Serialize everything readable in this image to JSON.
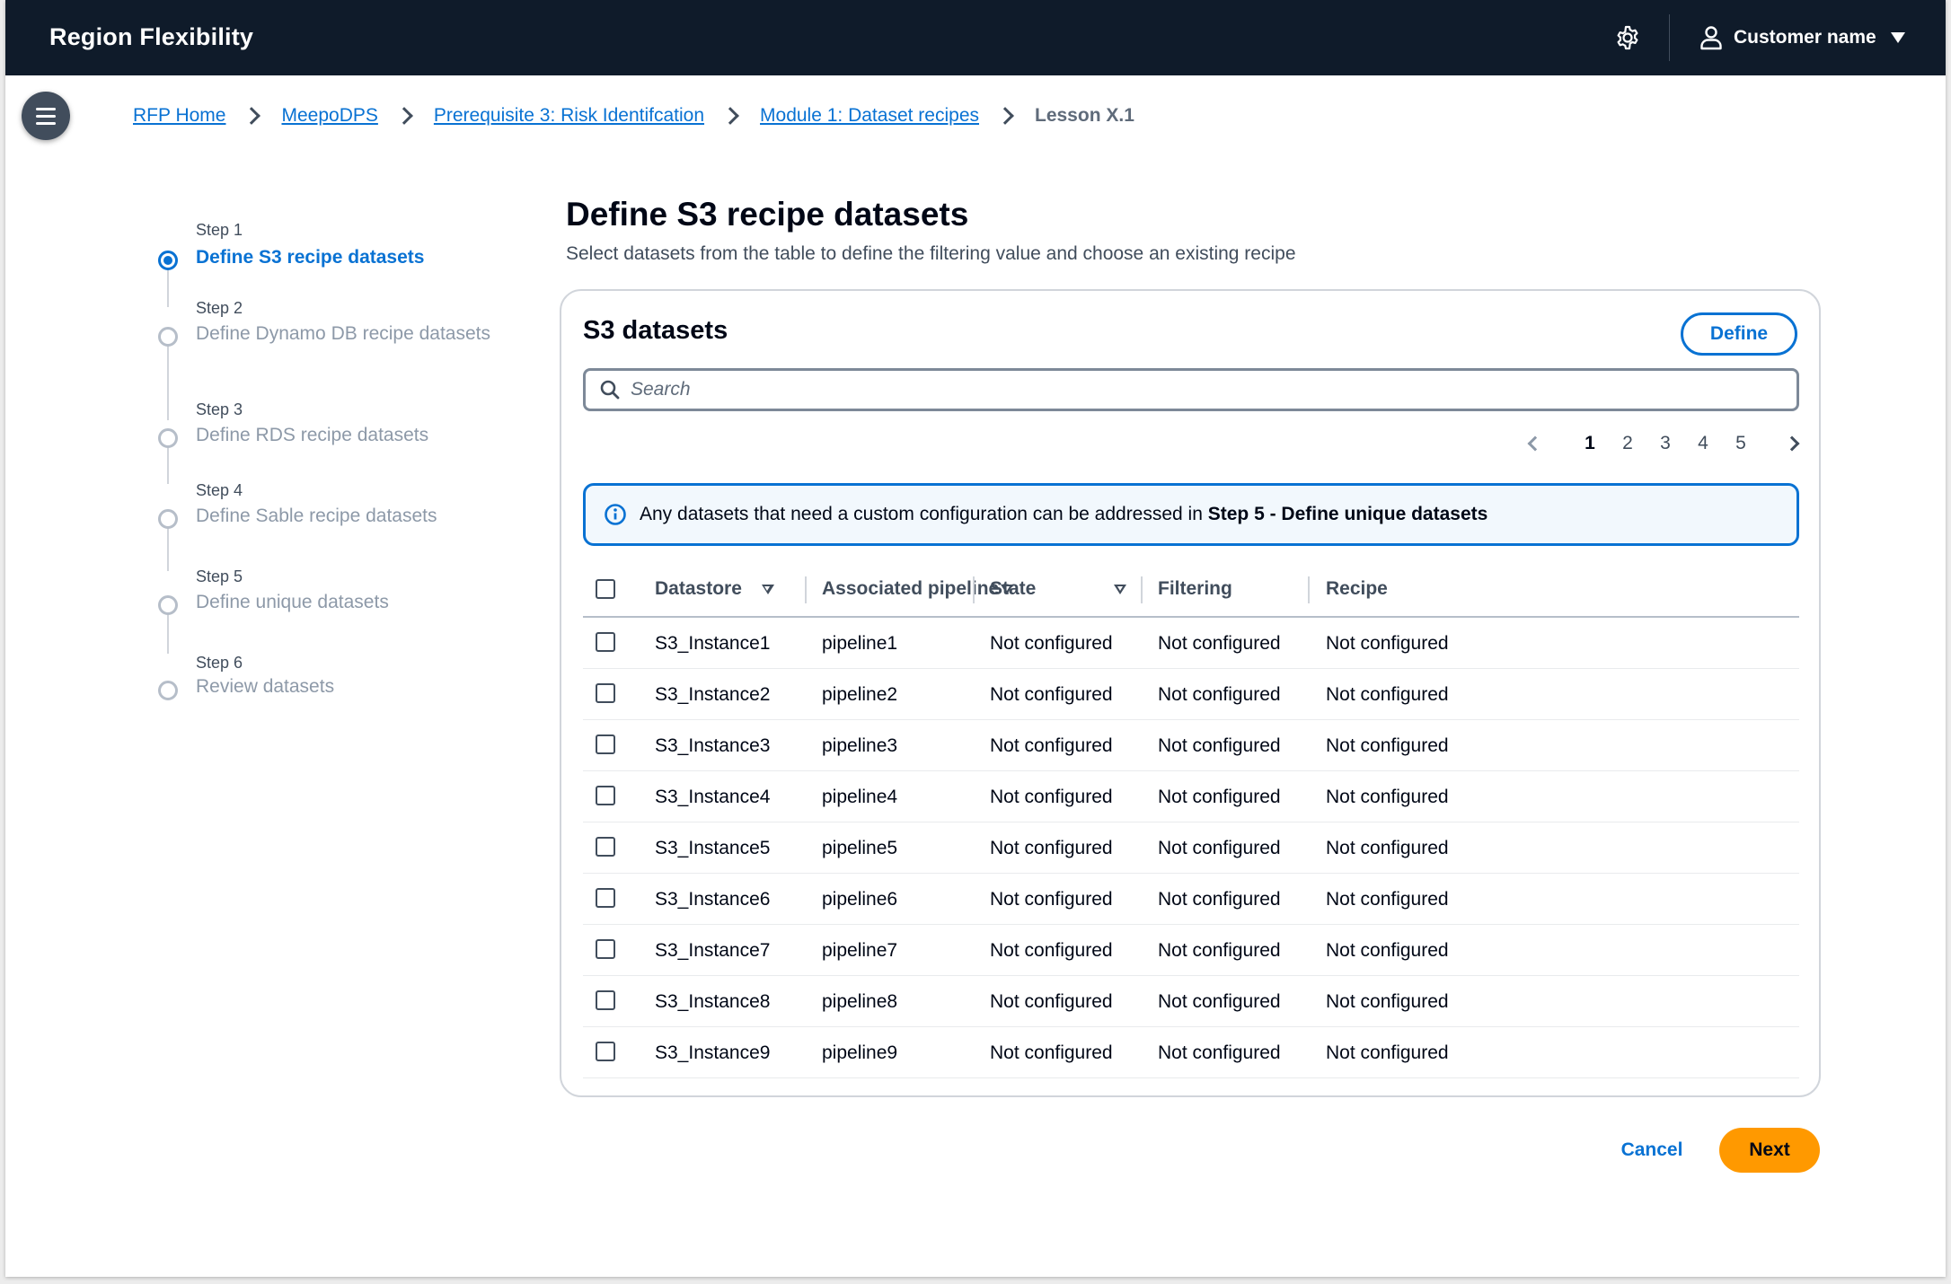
{
  "app": {
    "title": "Region Flexibility"
  },
  "topbar": {
    "settings_icon": "gear-icon",
    "user_icon": "user-icon",
    "user_name": "Customer name"
  },
  "breadcrumb": {
    "items": [
      "RFP Home",
      "MeepoDPS",
      "Prerequisite 3: Risk Identifcation",
      "Module 1: Dataset recipes"
    ],
    "current": "Lesson X.1"
  },
  "steps": [
    {
      "number": "Step 1",
      "label": "Define S3 recipe datasets",
      "active": true
    },
    {
      "number": "Step 2",
      "label": "Define Dynamo DB recipe datasets",
      "active": false
    },
    {
      "number": "Step 3",
      "label": "Define RDS recipe datasets",
      "active": false
    },
    {
      "number": "Step 4",
      "label": "Define Sable recipe datasets",
      "active": false
    },
    {
      "number": "Step 5",
      "label": "Define unique datasets",
      "active": false
    },
    {
      "number": "Step 6",
      "label": "Review datasets",
      "active": false
    }
  ],
  "page": {
    "title": "Define S3 recipe datasets",
    "description": "Select datasets from the table to define the filtering value and choose an existing recipe"
  },
  "card": {
    "title": "S3 datasets",
    "define_label": "Define",
    "search_placeholder": "Search",
    "pagination": {
      "pages": [
        "1",
        "2",
        "3",
        "4",
        "5"
      ],
      "current": "1"
    },
    "alert": {
      "text": "Any datasets that need a custom configuration can be addressed in ",
      "bold": "Step 5 - Define unique datasets"
    },
    "columns": [
      "Datastore",
      "Associated pipeline",
      "State",
      "Filtering",
      "Recipe"
    ],
    "rows": [
      [
        "S3_Instance1",
        "pipeline1",
        "Not configured",
        "Not configured",
        "Not configured"
      ],
      [
        "S3_Instance2",
        "pipeline2",
        "Not configured",
        "Not configured",
        "Not configured"
      ],
      [
        "S3_Instance3",
        "pipeline3",
        "Not configured",
        "Not configured",
        "Not configured"
      ],
      [
        "S3_Instance4",
        "pipeline4",
        "Not configured",
        "Not configured",
        "Not configured"
      ],
      [
        "S3_Instance5",
        "pipeline5",
        "Not configured",
        "Not configured",
        "Not configured"
      ],
      [
        "S3_Instance6",
        "pipeline6",
        "Not configured",
        "Not configured",
        "Not configured"
      ],
      [
        "S3_Instance7",
        "pipeline7",
        "Not configured",
        "Not configured",
        "Not configured"
      ],
      [
        "S3_Instance8",
        "pipeline8",
        "Not configured",
        "Not configured",
        "Not configured"
      ],
      [
        "S3_Instance9",
        "pipeline9",
        "Not configured",
        "Not configured",
        "Not configured"
      ]
    ]
  },
  "footer": {
    "cancel_label": "Cancel",
    "next_label": "Next"
  },
  "colors": {
    "navbar": "#0f1b2a",
    "accent": "#0972d3",
    "primary_button": "#ff9900"
  }
}
